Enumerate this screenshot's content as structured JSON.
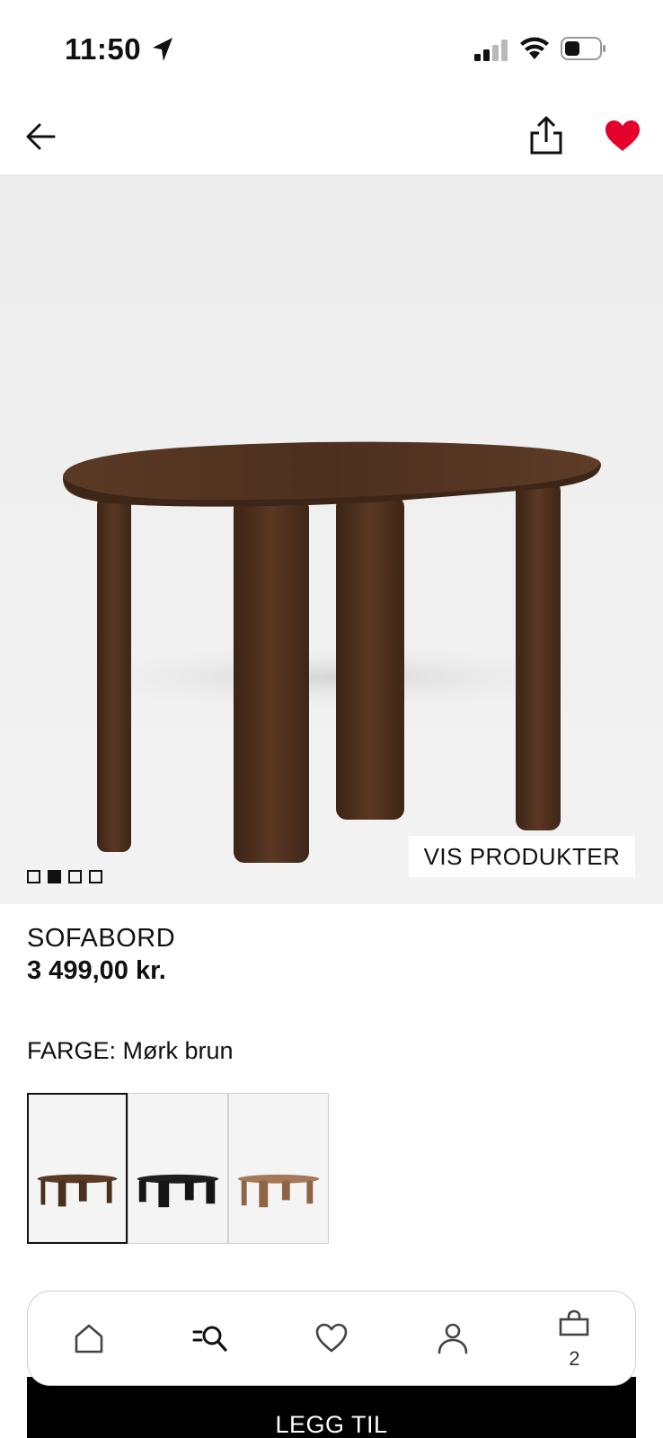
{
  "status_bar": {
    "time": "11:50",
    "icons": [
      "location-arrow-icon",
      "cellular-signal-icon",
      "wifi-icon",
      "battery-icon"
    ]
  },
  "nav": {
    "icons": [
      "back-arrow-icon",
      "share-icon",
      "heart-filled-icon"
    ],
    "favorite_color": "#e4002b"
  },
  "hero": {
    "carousel_pages": 4,
    "active_page": 2,
    "view_products_label": "VIS PRODUKTER"
  },
  "product": {
    "name": "SOFABORD",
    "price": "3 499,00 kr.",
    "color_label": "FARGE:",
    "color_value": "Mørk brun"
  },
  "swatches": [
    {
      "name": "Mørk brun",
      "color": "#5a3a26",
      "selected": true
    },
    {
      "name": "Svart",
      "color": "#1e1e1e",
      "selected": false
    },
    {
      "name": "Lys brun",
      "color": "#a5785a",
      "selected": false
    }
  ],
  "tab_bar": {
    "tabs": [
      "home-icon",
      "search-menu-icon",
      "heart-outline-icon",
      "account-icon",
      "bag-icon"
    ],
    "cart_count": "2"
  },
  "actions": {
    "add_to_cart_label": "LEGG TIL"
  }
}
